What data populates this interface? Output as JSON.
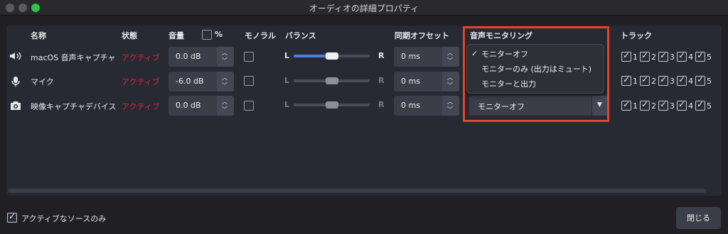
{
  "window": {
    "title": "オーディオの詳細プロパティ"
  },
  "headers": {
    "name": "名称",
    "status": "状態",
    "volume": "音量",
    "percent": "%",
    "mono": "モノラル",
    "balance": "バランス",
    "sync_offset": "同期オフセット",
    "monitoring": "音声モニタリング",
    "tracks": "トラック"
  },
  "rows": [
    {
      "icon": "speaker-icon",
      "name": "macOS 音声キャプチャ",
      "status": "アクティブ",
      "volume": "0.0 dB",
      "mono": false,
      "balance_left": "L",
      "balance_right": "R",
      "balance": 0.5,
      "offset": "0 ms",
      "tracks": [
        "1",
        "2",
        "3",
        "4",
        "5"
      ]
    },
    {
      "icon": "microphone-icon",
      "name": "マイク",
      "status": "アクティブ",
      "volume": "-6.0 dB",
      "mono": false,
      "balance_left": "L",
      "balance_right": "R",
      "balance": 0.5,
      "offset": "0 ms",
      "tracks": [
        "1",
        "2",
        "3",
        "4",
        "5"
      ]
    },
    {
      "icon": "camera-icon",
      "name": "映像キャプチャデバイス",
      "status": "アクティブ",
      "volume": "0.0 dB",
      "mono": false,
      "balance_left": "L",
      "balance_right": "R",
      "balance": 0.5,
      "offset": "0 ms",
      "monitoring": "モニターオフ",
      "tracks": [
        "1",
        "2",
        "3",
        "4",
        "5"
      ]
    }
  ],
  "monitoring_dropdown": {
    "selected": "モニターオフ",
    "options": [
      "モニターオフ",
      "モニターのみ (出力はミュート)",
      "モニターと出力"
    ]
  },
  "footer": {
    "active_only_label": "アクティブなソースのみ",
    "active_only_checked": true,
    "close_label": "閉じる"
  },
  "colors": {
    "active_status": "#e3203f",
    "slider_fill": "#4b7de0",
    "highlight_box": "#e8422d"
  }
}
